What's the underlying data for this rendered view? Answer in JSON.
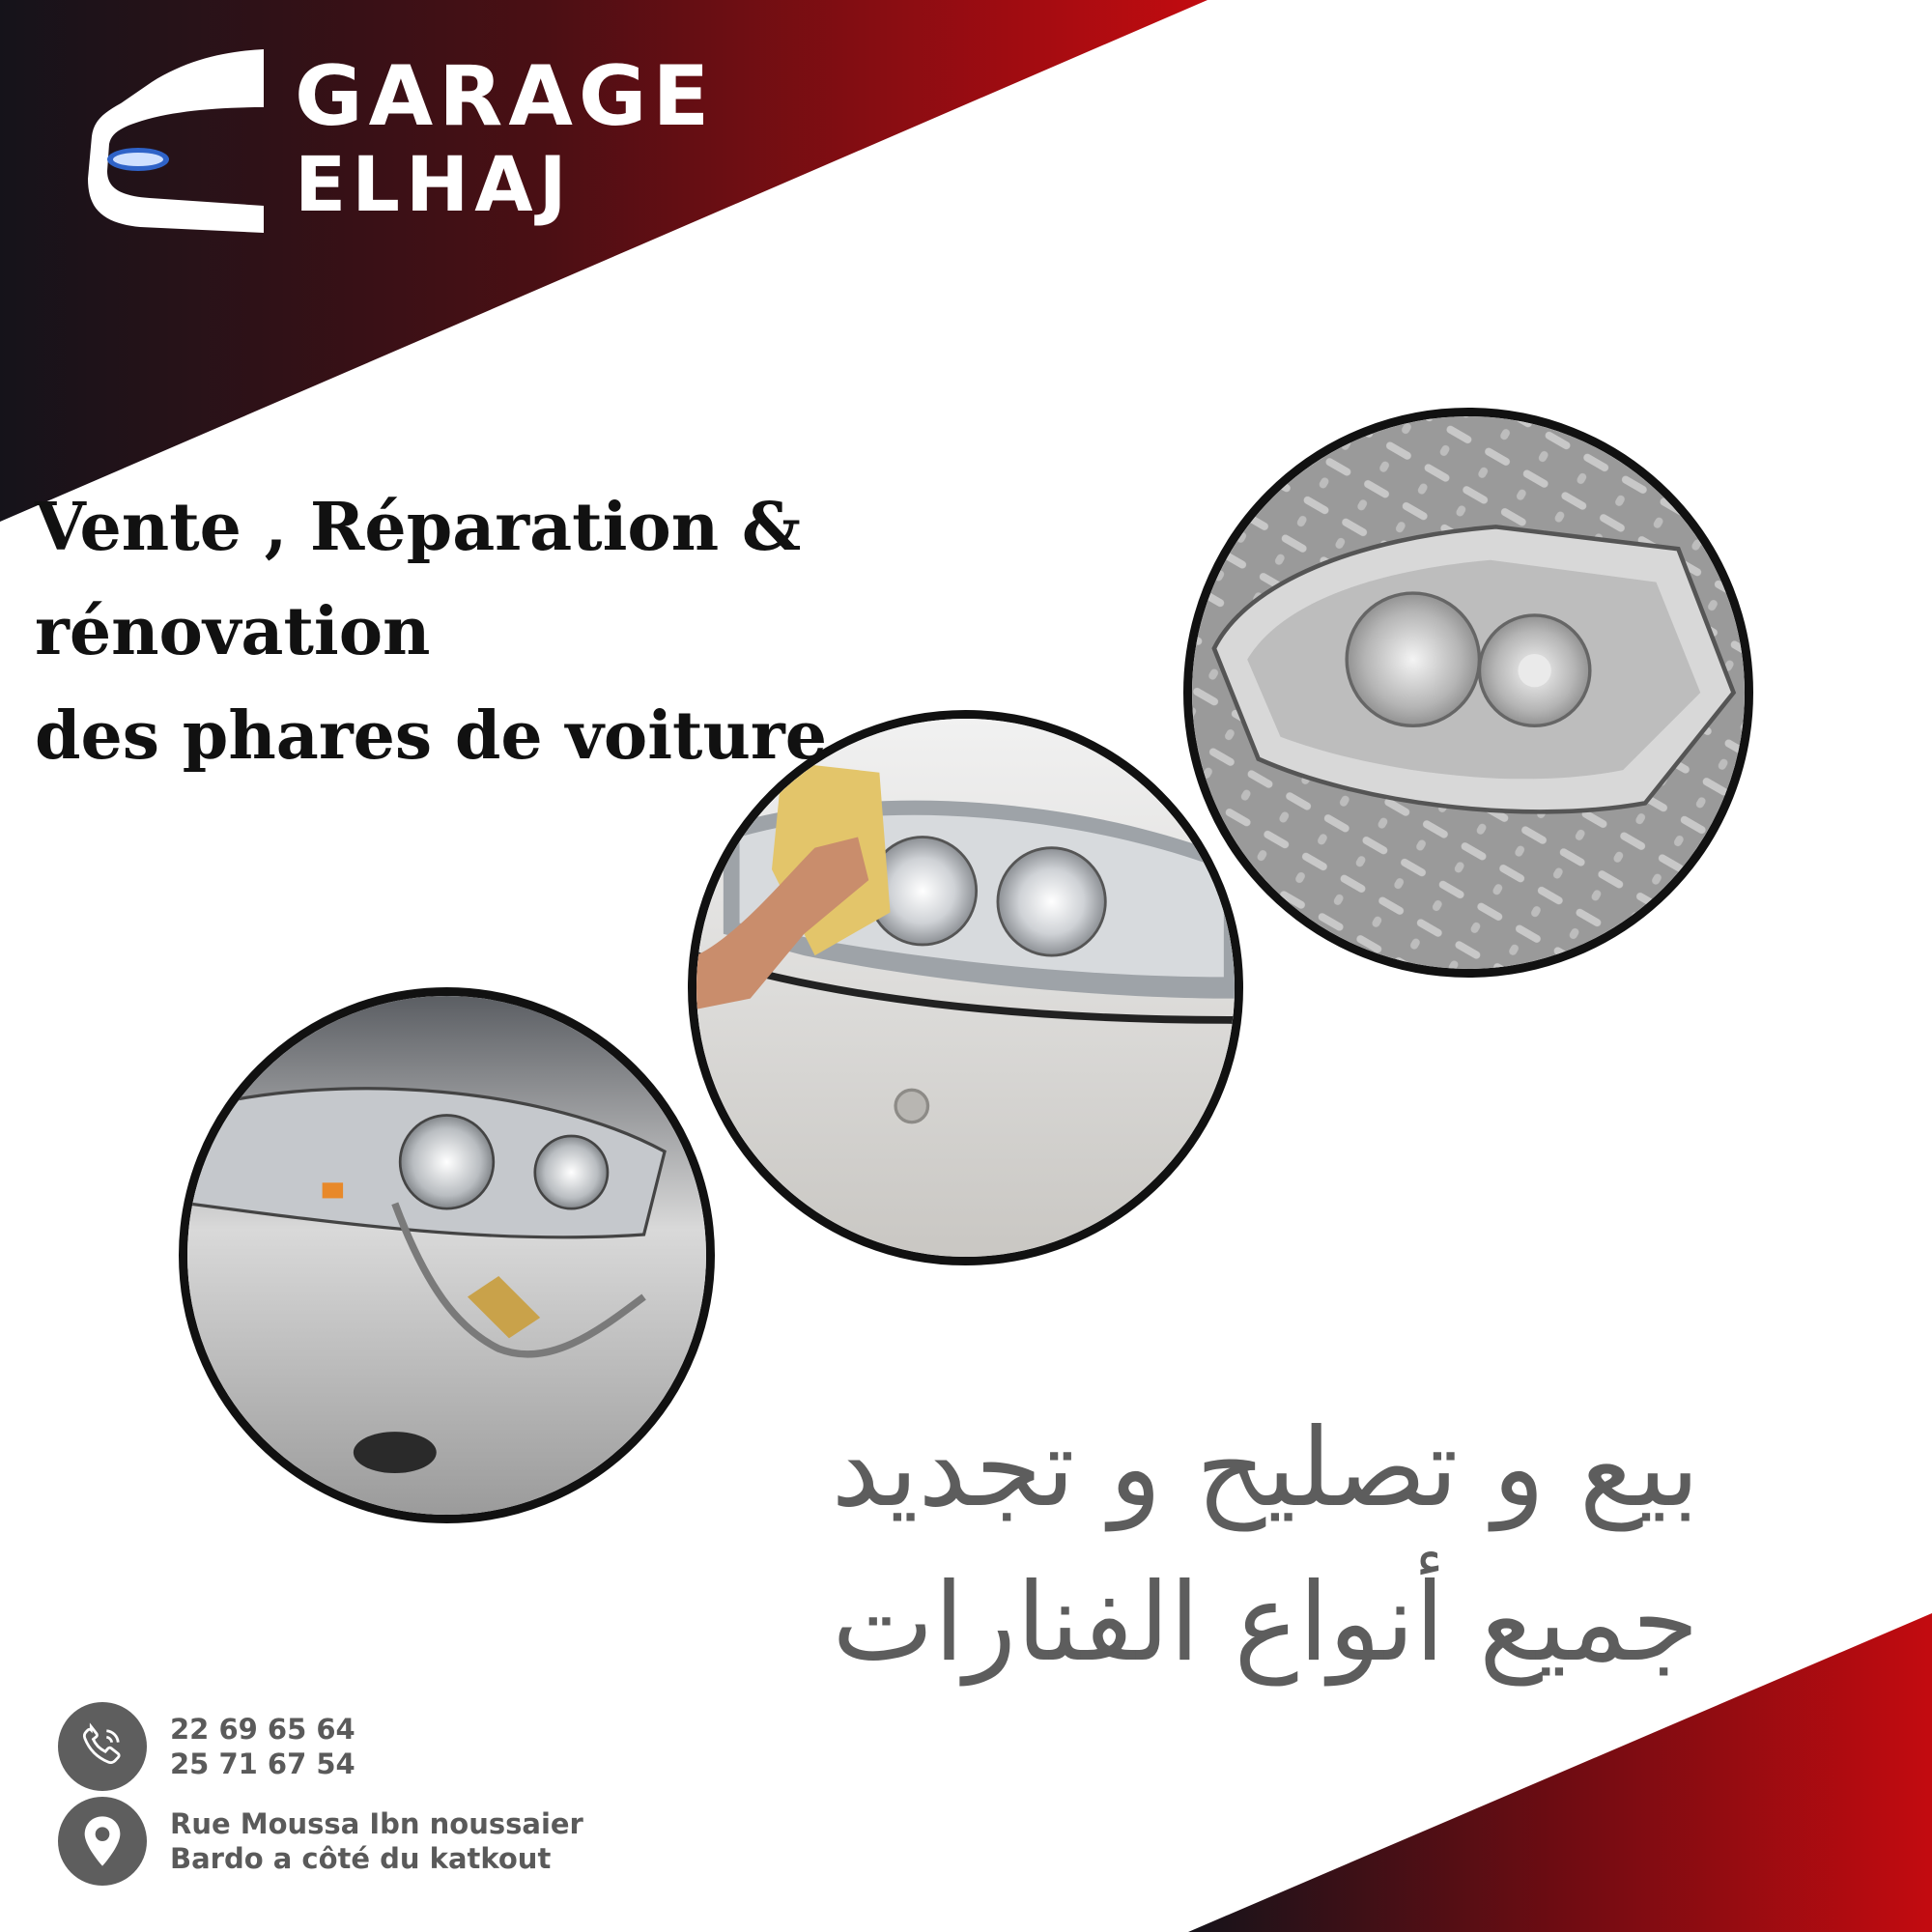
{
  "brand": {
    "name_line1": "GARAGE",
    "name_line2": "ELHAJ",
    "logo_icon": "car-front-icon"
  },
  "headline": {
    "line1": "Vente , Réparation & rénovation",
    "line2": "des phares de voiture"
  },
  "photos": [
    {
      "name": "damaged-headlight-photo",
      "description_icon": "headlight-damaged"
    },
    {
      "name": "headlight-polishing-photo",
      "description_icon": "headlight-cleaning"
    },
    {
      "name": "headlight-unit-photo",
      "description_icon": "headlight-unit"
    }
  ],
  "arabic": {
    "line1": "بيع و تصليح و تجديد",
    "line2": "جميع أنواع الفنارات"
  },
  "contact": {
    "phone_icon": "phone-icon",
    "phone1": "22 69 65 64",
    "phone2": "25 71  67  54",
    "location_icon": "location-pin-icon",
    "address_line1": "Rue Moussa Ibn noussaier",
    "address_line2": "Bardo a côté du katkout"
  },
  "colors": {
    "dark": "#16131a",
    "red": "#c10a10",
    "text_grey": "#5d5d5d"
  }
}
